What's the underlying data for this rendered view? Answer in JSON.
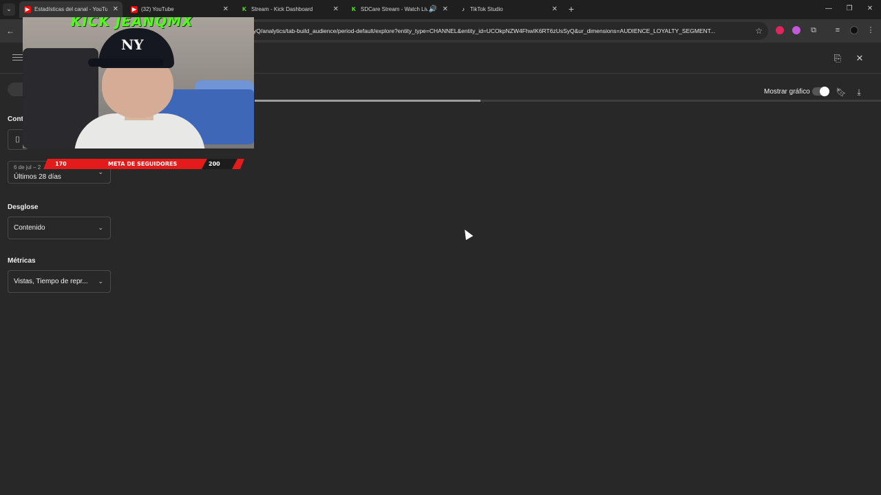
{
  "browser": {
    "tabs": [
      {
        "title": "Estadísticas del canal - YouTube",
        "favicon": "youtube-icon",
        "color": "#ff0000"
      },
      {
        "title": "(32) YouTube",
        "favicon": "youtube-icon",
        "color": "#ff0000"
      },
      {
        "title": "Stream - Kick Dashboard",
        "favicon": "kick-icon",
        "color": "#53fc18"
      },
      {
        "title": "SDCare Stream - Watch Live",
        "favicon": "kick-icon",
        "color": "#53fc18"
      },
      {
        "title": "TikTok Studio",
        "favicon": "tiktok-icon",
        "color": "#ffffff"
      }
    ],
    "url": "yQ/analytics/tab-build_audience/period-default/explore?entity_type=CHANNEL&entity_id=UCOkpNZW4FhwIK6RT6zUsSyQ&ur_dimensions=AUDIENCE_LOYALTY_SEGMENT..."
  },
  "toolbar": {
    "show_chart_label": "Mostrar gráfico",
    "show_chart_on": true
  },
  "progress": {
    "value": 0.36
  },
  "sidebar": {
    "content_label": "Cont",
    "period": {
      "sublabel": "6 de jul – 2",
      "value": "Últimos 28 días"
    },
    "breakdown": {
      "label": "Desglose",
      "value": "Contenido"
    },
    "metrics": {
      "label": "Métricas",
      "value": "Vistas, Tiempo de repr..."
    }
  },
  "overlay": {
    "channel": "KICK JEANQMX",
    "goal": {
      "current": "170",
      "label": "META DE SEGUIDORES",
      "target": "200"
    },
    "cap_logo": "NY"
  },
  "colors": {
    "accent_kick": "#53fc18",
    "goal_red": "#e31b1b",
    "background": "#282828"
  }
}
